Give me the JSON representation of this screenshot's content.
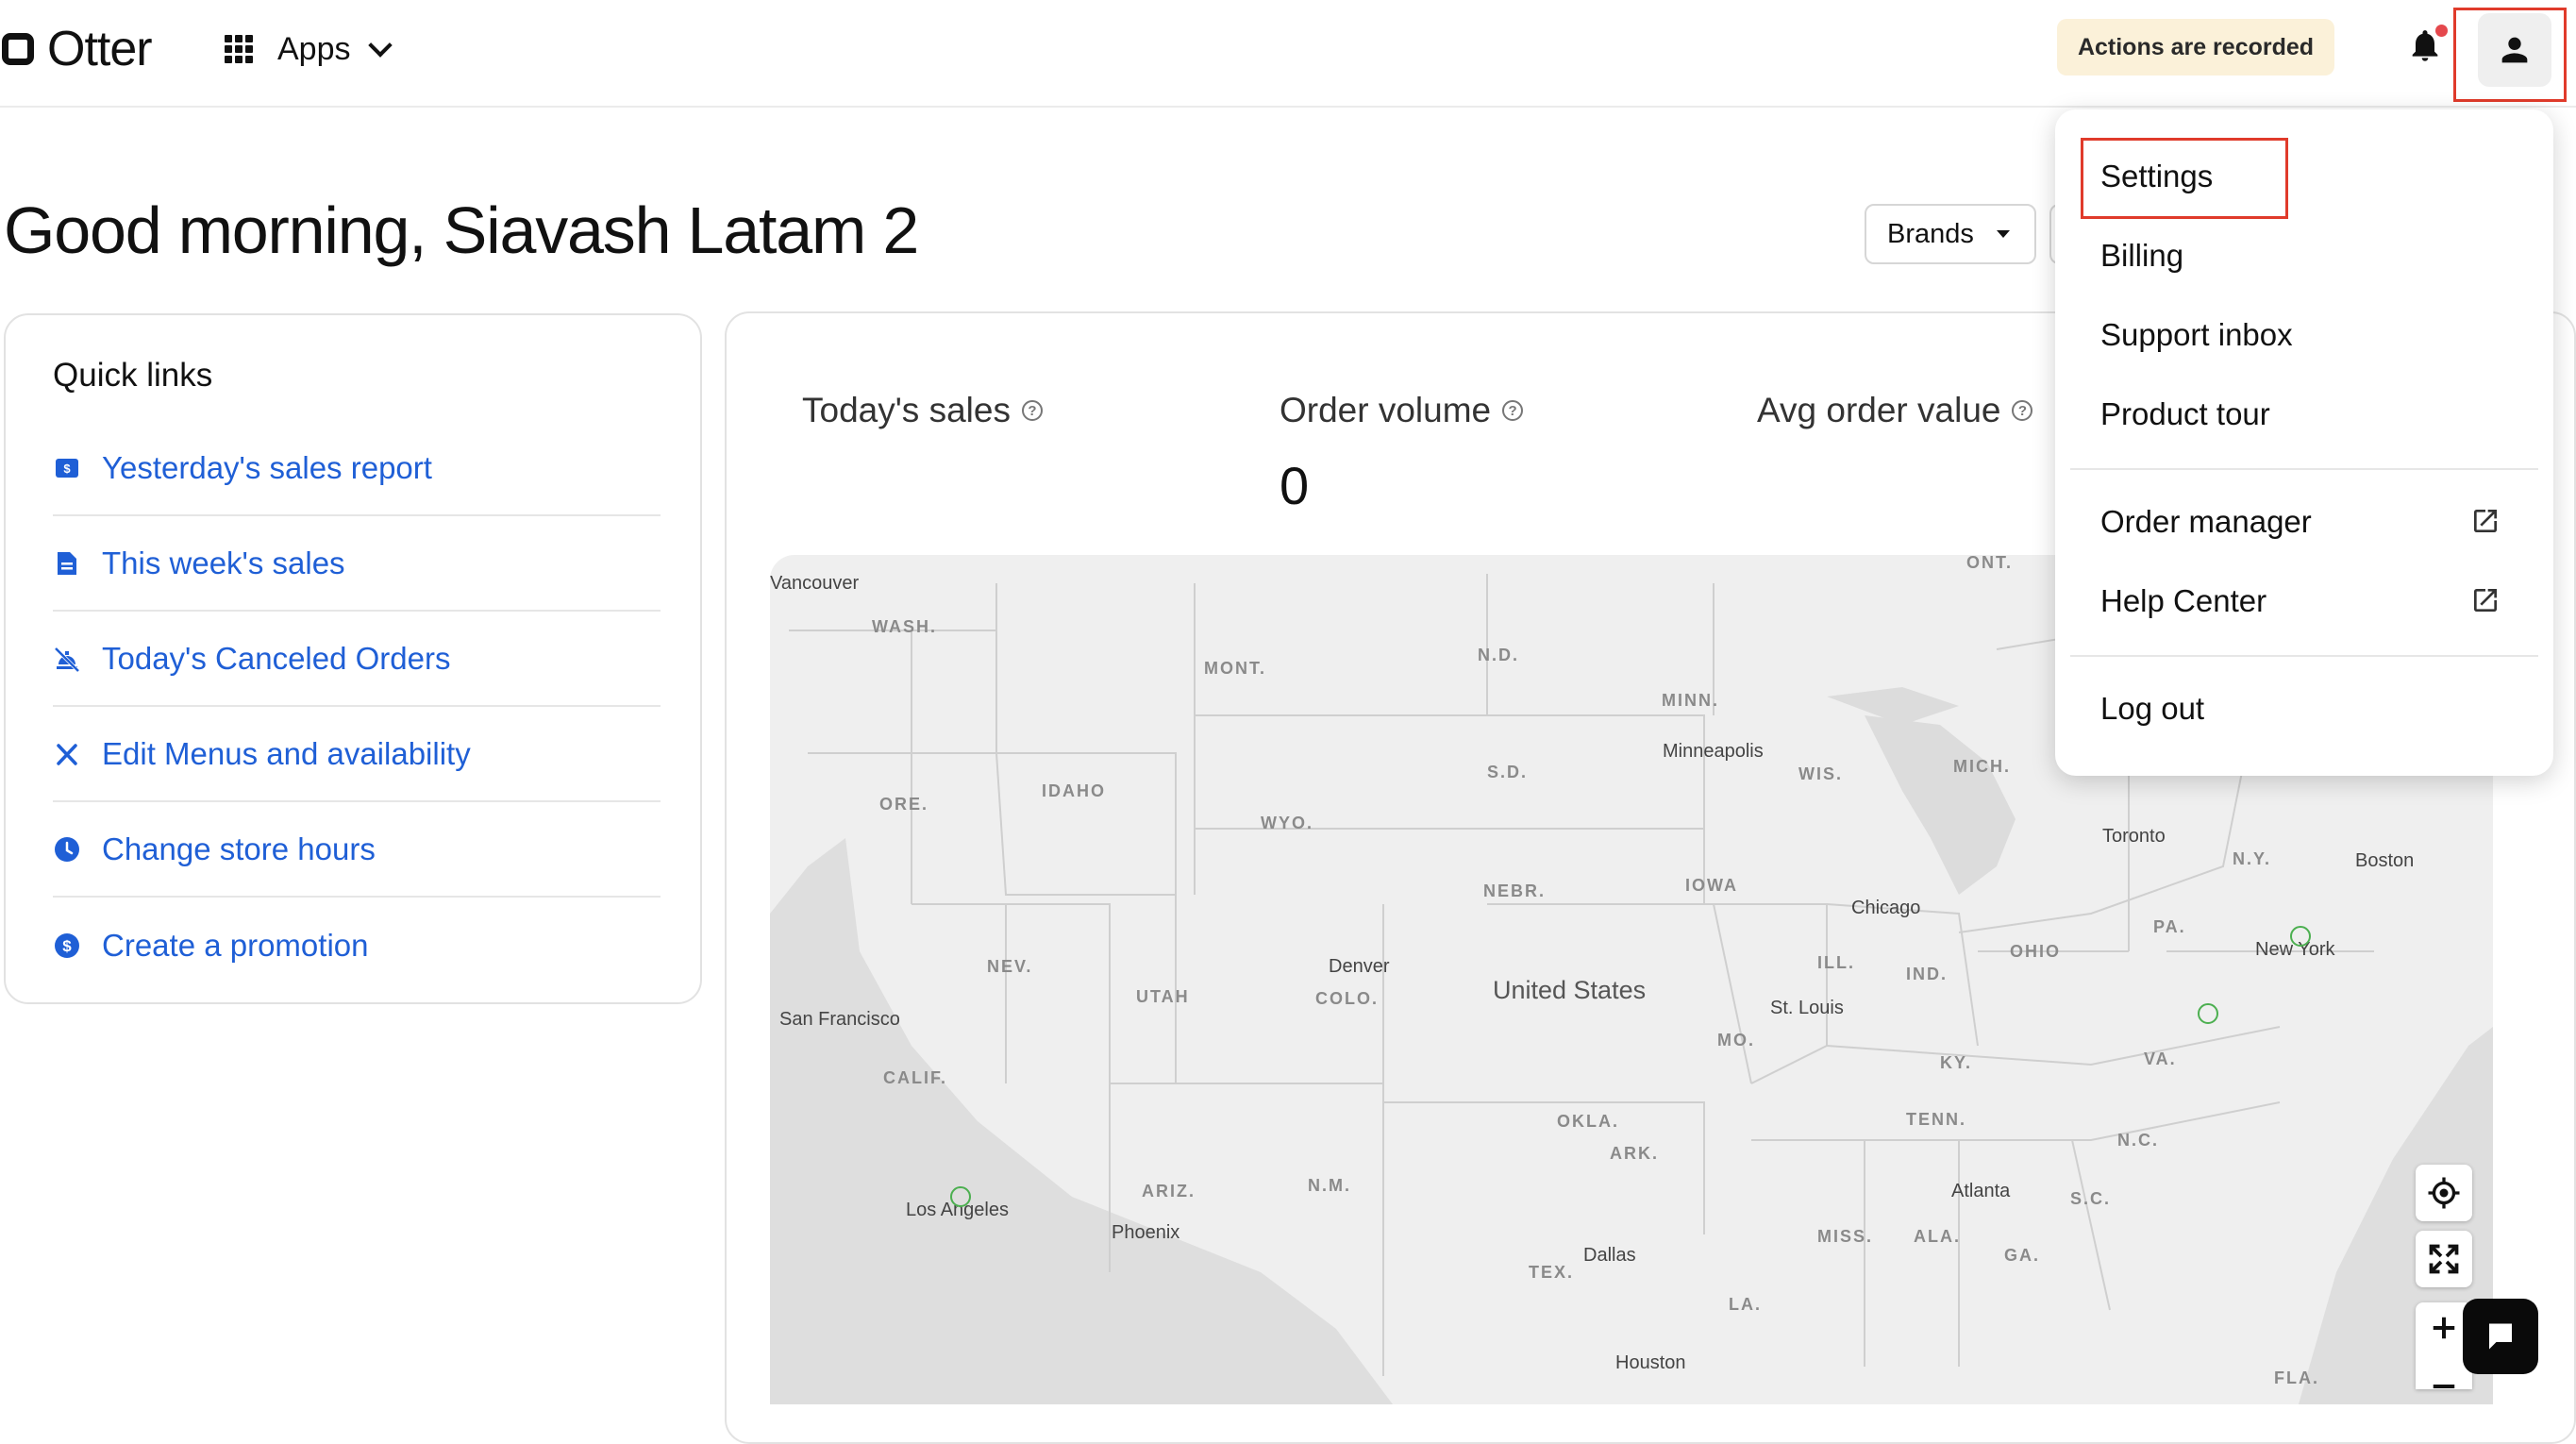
{
  "header": {
    "logo_text": "Otter",
    "apps_label": "Apps",
    "recorded_badge": "Actions are recorded"
  },
  "greeting": "Good morning, Siavash Latam 2",
  "filters": {
    "brands_label": "Brands"
  },
  "quick_links": {
    "title": "Quick links",
    "items": [
      {
        "label": "Yesterday's sales report",
        "icon": "dollar-doc-icon"
      },
      {
        "label": "This week's sales",
        "icon": "document-icon"
      },
      {
        "label": "Today's Canceled Orders",
        "icon": "canceled-orders-icon"
      },
      {
        "label": "Edit Menus and availability",
        "icon": "utensils-icon"
      },
      {
        "label": "Change store hours",
        "icon": "clock-icon"
      },
      {
        "label": "Create a promotion",
        "icon": "dollar-circle-icon"
      }
    ]
  },
  "metrics": [
    {
      "label": "Today's sales",
      "value": ""
    },
    {
      "label": "Order volume",
      "value": "0"
    },
    {
      "label": "Avg order value",
      "value": ""
    }
  ],
  "map": {
    "labels": [
      "Vancouver",
      "WASH.",
      "MONT.",
      "N.D.",
      "MINN.",
      "ONT.",
      "ORE.",
      "IDAHO",
      "WYO.",
      "S.D.",
      "Minneapolis",
      "WIS.",
      "MICH.",
      "Toronto",
      "N.Y.",
      "Boston",
      "NEBR.",
      "IOWA",
      "Chicago",
      "PA.",
      "New York",
      "NEV.",
      "UTAH",
      "Denver",
      "COLO.",
      "United States",
      "ILL.",
      "IND.",
      "OHIO",
      "San Francisco",
      "St. Louis",
      "MO.",
      "KY.",
      "VA.",
      "CALIF.",
      "OKLA.",
      "TENN.",
      "N.C.",
      "ARK.",
      "ARIZ.",
      "N.M.",
      "Atlanta",
      "S.C.",
      "Los Angeles",
      "Phoenix",
      "MISS.",
      "ALA.",
      "GA.",
      "Dallas",
      "TEX.",
      "LA.",
      "Houston",
      "FLA."
    ]
  },
  "user_menu": {
    "items": [
      {
        "label": "Settings"
      },
      {
        "label": "Billing"
      },
      {
        "label": "Support inbox"
      },
      {
        "label": "Product tour"
      },
      {
        "label": "Order manager"
      },
      {
        "label": "Help Center"
      },
      {
        "label": "Log out"
      }
    ]
  },
  "colors": {
    "link_blue": "#1f5fd6",
    "highlight_red": "#e03b2b",
    "badge_bg": "#fbf1d9",
    "notification_dot": "#e5484d"
  }
}
